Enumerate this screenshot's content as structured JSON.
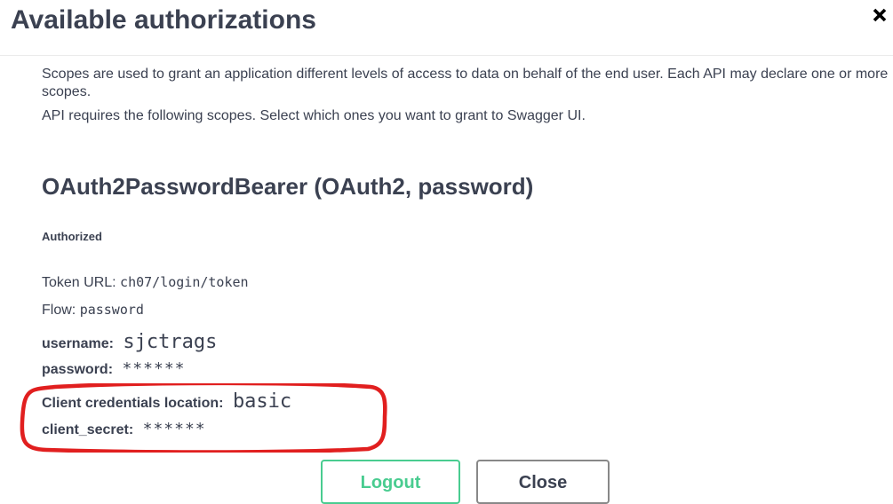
{
  "modal": {
    "title": "Available authorizations",
    "close_icon": "close-x-icon"
  },
  "scopes": {
    "description": "Scopes are used to grant an application different levels of access to data on behalf of the end user. Each API may declare one or more scopes.",
    "requirement": "API requires the following scopes. Select which ones you want to grant to Swagger UI."
  },
  "scheme": {
    "title": "OAuth2PasswordBearer (OAuth2, password)",
    "status": "Authorized",
    "token_url_label": "Token URL:",
    "token_url_value": "ch07/login/token",
    "flow_label": "Flow:",
    "flow_value": "password",
    "username_label": "username:",
    "username_value": "sjctrags",
    "password_label": "password:",
    "password_value": "******",
    "client_location_label": "Client credentials location:",
    "client_location_value": "basic",
    "client_secret_label": "client_secret:",
    "client_secret_value": "******"
  },
  "buttons": {
    "logout": "Logout",
    "close": "Close"
  },
  "colors": {
    "text": "#3b4151",
    "logout_accent": "#49cc90",
    "highlight_annotation": "#e11f1f"
  }
}
